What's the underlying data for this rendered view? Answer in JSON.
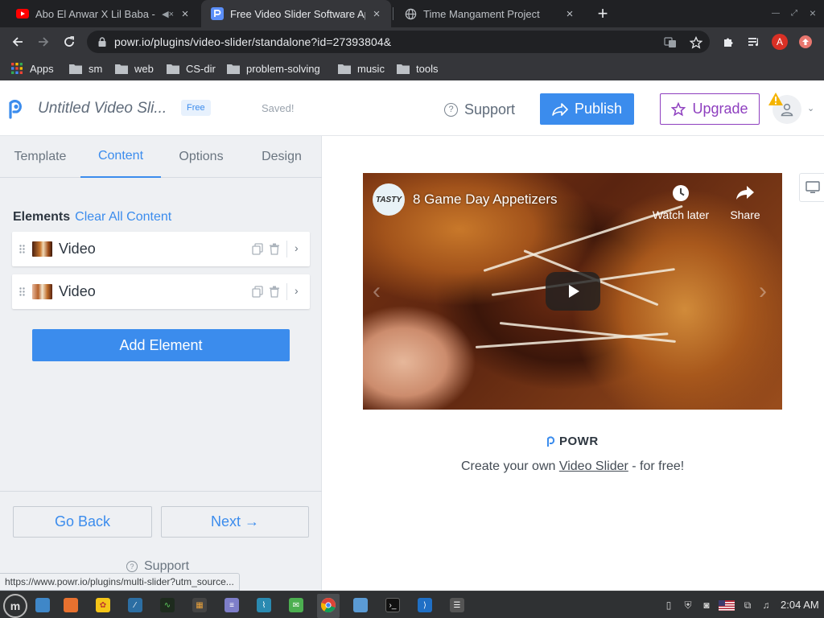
{
  "browser": {
    "tabs": [
      {
        "title": "Abo El Anwar X Lil Baba -",
        "favicon": "youtube-icon",
        "muted": true
      },
      {
        "title": "Free Video Slider Software Ap",
        "favicon": "powr-icon",
        "active": true
      },
      {
        "title": "Time Mangament Project",
        "favicon": "globe-icon"
      }
    ],
    "url": "powr.io/plugins/video-slider/standalone?id=27393804&",
    "profile_initial": "A",
    "bookmarks": [
      "Apps",
      "sm",
      "web",
      "CS-dir",
      "problem-solving",
      "music",
      "tools"
    ]
  },
  "header": {
    "title": "Untitled Video Sli...",
    "badge": "Free",
    "saved": "Saved!",
    "support": "Support",
    "publish": "Publish",
    "upgrade": "Upgrade"
  },
  "panel": {
    "tabs": [
      "Template",
      "Content",
      "Options",
      "Design"
    ],
    "active_tab": "Content",
    "elements_label": "Elements",
    "clear_all": "Clear All Content",
    "elements": [
      {
        "label": "Video"
      },
      {
        "label": "Video"
      }
    ],
    "add_element": "Add Element",
    "go_back": "Go Back",
    "next": "Next →",
    "support": "Support"
  },
  "status_bar": {
    "url": "https://www.powr.io/plugins/multi-slider?utm_source..."
  },
  "preview": {
    "video": {
      "channel": "TASTY",
      "title": "8 Game Day Appetizers",
      "watch_later": "Watch later",
      "share": "Share"
    },
    "brand": "POWR",
    "cta_prefix": "Create your own ",
    "cta_link": "Video Slider",
    "cta_suffix": " - for free!"
  },
  "taskbar": {
    "clock": "2:04 AM"
  },
  "colors": {
    "accent": "#3b8ced",
    "upgrade": "#8e3fbf",
    "panel_bg": "#eef0f3"
  }
}
